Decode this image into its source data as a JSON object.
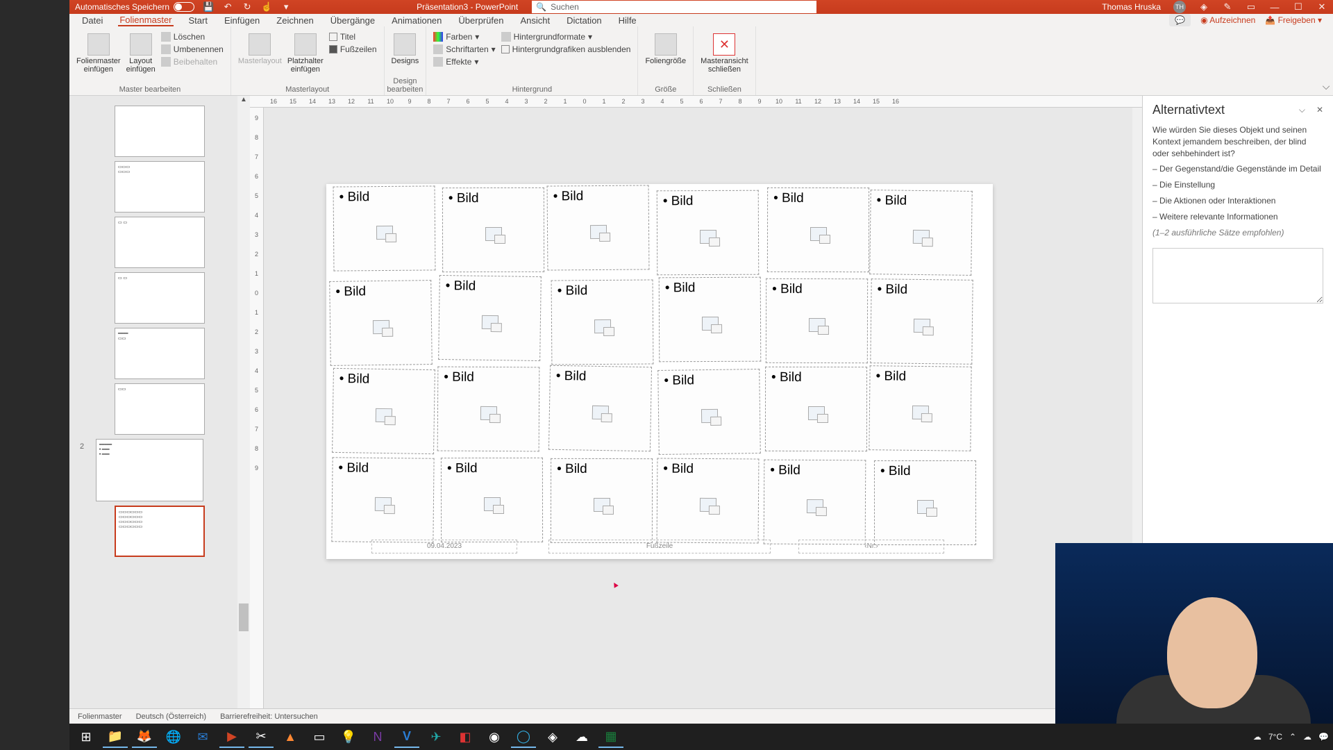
{
  "titlebar": {
    "autosave_label": "Automatisches Speichern",
    "doc_title": "Präsentation3 - PowerPoint",
    "search_placeholder": "Suchen",
    "user_name": "Thomas Hruska",
    "user_initials": "TH"
  },
  "menubar": {
    "tabs": [
      "Datei",
      "Folienmaster",
      "Start",
      "Einfügen",
      "Zeichnen",
      "Übergänge",
      "Animationen",
      "Überprüfen",
      "Ansicht",
      "Dictation",
      "Hilfe"
    ],
    "active_index": 1,
    "record": "Aufzeichnen",
    "share": "Freigeben"
  },
  "ribbon": {
    "groups": {
      "master_edit": {
        "label": "Master bearbeiten",
        "insert_master": "Folienmaster\neinfügen",
        "insert_layout": "Layout\neinfügen",
        "delete": "Löschen",
        "rename": "Umbenennen",
        "preserve": "Beibehalten"
      },
      "master_layout": {
        "label": "Masterlayout",
        "masterlayout_btn": "Masterlayout",
        "placeholder": "Platzhalter\neinfügen",
        "title_chk": "Titel",
        "footer_chk": "Fußzeilen"
      },
      "design_edit": {
        "label": "Design bearbeiten",
        "designs": "Designs"
      },
      "background": {
        "label": "Hintergrund",
        "colors": "Farben",
        "fonts": "Schriftarten",
        "effects": "Effekte",
        "bg_formats": "Hintergrundformate",
        "hide_bg": "Hintergrundgrafiken ausblenden"
      },
      "size": {
        "label": "Größe",
        "slide_size": "Foliengröße"
      },
      "close": {
        "label": "Schließen",
        "close_master": "Masteransicht\nschließen"
      }
    }
  },
  "ruler": {
    "h": [
      "16",
      "15",
      "14",
      "13",
      "12",
      "11",
      "10",
      "9",
      "8",
      "7",
      "6",
      "5",
      "4",
      "3",
      "2",
      "1",
      "0",
      "1",
      "2",
      "3",
      "4",
      "5",
      "6",
      "7",
      "8",
      "9",
      "10",
      "11",
      "12",
      "13",
      "14",
      "15",
      "16"
    ],
    "v": [
      "9",
      "8",
      "7",
      "6",
      "5",
      "4",
      "3",
      "2",
      "1",
      "0",
      "1",
      "2",
      "3",
      "4",
      "5",
      "6",
      "7",
      "8",
      "9"
    ]
  },
  "slide": {
    "placeholder_label": "Bild",
    "footer_date": "09.04.2023",
    "footer_center": "Fußzeile",
    "footer_num": "‹Nr.›"
  },
  "altpane": {
    "title": "Alternativtext",
    "intro": "Wie würden Sie dieses Objekt und seinen Kontext jemandem beschreiben, der blind oder sehbehindert ist?",
    "bullets": [
      "– Der Gegenstand/die Gegenstände im Detail",
      "– Die Einstellung",
      "– Die Aktionen oder Interaktionen",
      "– Weitere relevante Informationen"
    ],
    "hint": "(1–2 ausführliche Sätze empfohlen)"
  },
  "statusbar": {
    "view": "Folienmaster",
    "lang": "Deutsch (Österreich)",
    "a11y": "Barrierefreiheit: Untersuchen"
  },
  "taskbar": {
    "temp": "7°C"
  },
  "thumbs": {
    "master2_num": "2"
  }
}
